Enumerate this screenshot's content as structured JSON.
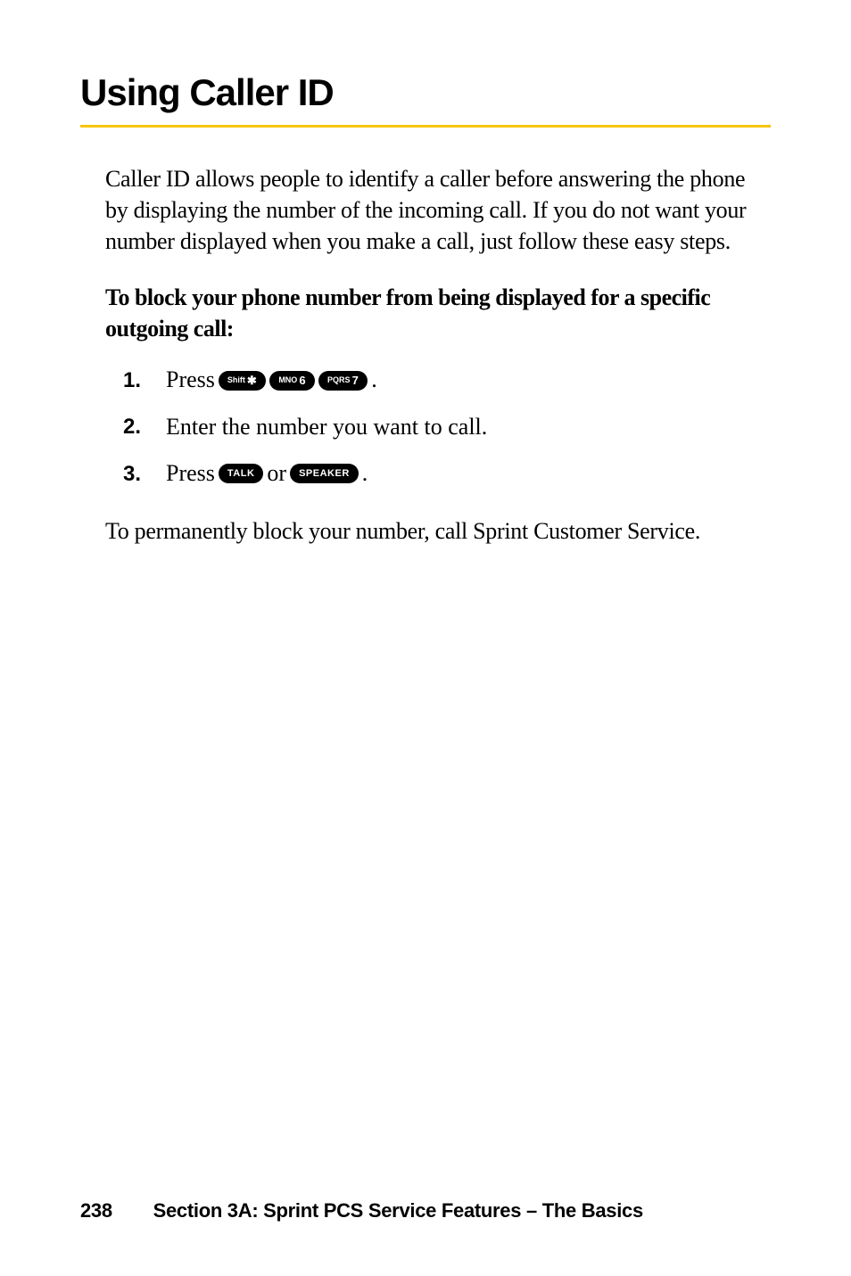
{
  "title": "Using Caller ID",
  "intro": "Caller ID allows people to identify a caller before answering the phone by displaying the number of the incoming call. If you do not want your number displayed when you make a call, just follow these easy steps.",
  "subhead": "To block your phone number from being displayed for a specific outgoing call:",
  "steps": {
    "s1": {
      "num": "1.",
      "pre": "Press ",
      "post": "."
    },
    "s2": {
      "num": "2.",
      "text": "Enter the number you want to call."
    },
    "s3": {
      "num": "3.",
      "pre": "Press ",
      "mid": " or ",
      "post": "."
    }
  },
  "keys": {
    "shift_small": "Shift",
    "shift_big": "✱",
    "mno_small": "MNO",
    "mno_big": "6",
    "pqrs_small": "PQRS",
    "pqrs_big": "7",
    "talk": "TALK",
    "speaker": "SPEAKER"
  },
  "outro": "To permanently block your number, call Sprint Customer Service.",
  "footer": {
    "page": "238",
    "section": "Section 3A: Sprint PCS Service Features – The Basics"
  }
}
